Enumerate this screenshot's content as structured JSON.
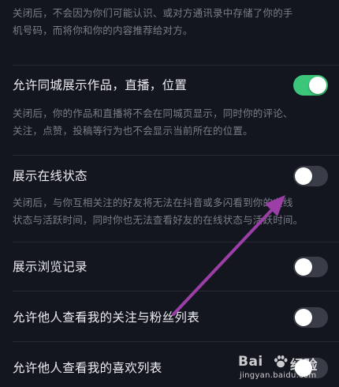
{
  "settings": {
    "contacts_desc": {
      "line1": "关闭后，不会因为你们可能认识、或对方通讯录中存储了你的手",
      "line2": "机号码，而将你和你的内容推荐给对方。"
    },
    "same_city": {
      "title": "允许同城展示作品，直播，位置",
      "enabled": true,
      "desc_line1": "关闭后，你的作品和直播将不会在同城页显示，同时你的评论、",
      "desc_line2": "关注，点赞，投稿等行为也不会显示当前所在的位置。"
    },
    "online_status": {
      "title": "展示在线状态",
      "enabled": false,
      "desc_line1": "关闭后，与你互相关注的好友将无法在抖音或多闪看到你的在线",
      "desc_line2": "状态与活跃时间，同时你也无法查看好友的在线状态与活跃时间。"
    },
    "browse_history": {
      "title": "展示浏览记录",
      "enabled": false
    },
    "follow_list": {
      "title": "允许他人查看我的关注与粉丝列表",
      "enabled": false
    },
    "likes_list": {
      "title": "允许他人查看我的喜欢列表",
      "enabled": false
    }
  },
  "colors": {
    "background": "#14161f",
    "toggle_on": "#3cc67a",
    "toggle_off": "#3a3d48",
    "arrow": "#9b3fa6"
  },
  "watermark": {
    "brand": "Bai",
    "brand_suffix": "经验",
    "url": "jingyan.baidu.com"
  }
}
